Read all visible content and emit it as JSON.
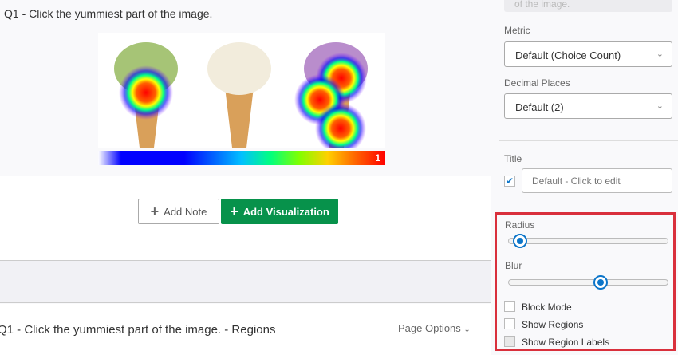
{
  "question_title": "Q1 - Click the yummiest part of the image.",
  "heatmap": {
    "scale_max_label": "1"
  },
  "buttons": {
    "add_note": "Add Note",
    "add_visualization": "Add Visualization"
  },
  "regions": {
    "title": "Q1 - Click the yummiest part of the image. - Regions",
    "page_options": "Page Options"
  },
  "sidebar": {
    "description_tail": "of the image.",
    "metric": {
      "label": "Metric",
      "value": "Default (Choice Count)"
    },
    "decimal": {
      "label": "Decimal Places",
      "value": "Default (2)"
    },
    "title": {
      "label": "Title",
      "placeholder": "Default - Click to edit",
      "checked": true
    },
    "radius": {
      "label": "Radius",
      "value_fraction": 0.07
    },
    "blur": {
      "label": "Blur",
      "value_fraction": 0.58
    },
    "options": [
      {
        "label": "Block Mode",
        "checked": false
      },
      {
        "label": "Show Regions",
        "checked": false
      },
      {
        "label": "Show Region Labels",
        "checked": false,
        "disabled": true
      }
    ]
  },
  "colors": {
    "accent": "#0b75c9",
    "primary_button": "#07924b",
    "highlight": "#d9303c"
  }
}
